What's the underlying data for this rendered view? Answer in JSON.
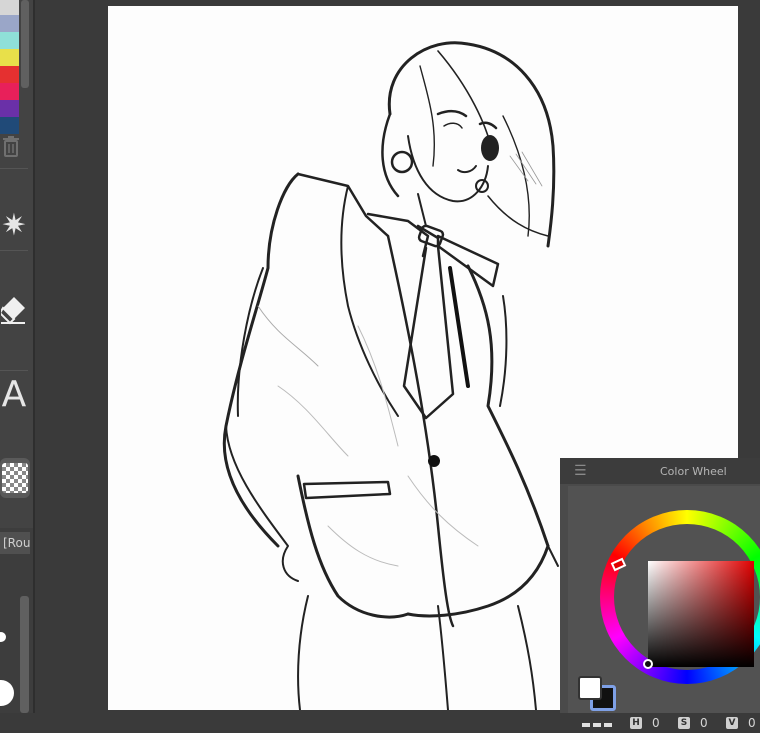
{
  "palette": {
    "swatches": [
      "#d6d6d6",
      "#9aa6c8",
      "#8fe0d8",
      "#e8e04a",
      "#e53030",
      "#e8205a",
      "#6a30a8",
      "#204a78"
    ]
  },
  "tools": {
    "text_tool_glyph": "A",
    "burst_glyph": "✷"
  },
  "brush_panel": {
    "tab_label": "[Rou"
  },
  "color_wheel": {
    "title": "Color Wheel",
    "foreground_color": "#ffffff",
    "background_color": "#111111",
    "hue_accent": "#e00000",
    "h_label": "H",
    "h_value": "0",
    "s_label": "S",
    "s_value": "0",
    "v_label": "V",
    "v_value": "0"
  }
}
